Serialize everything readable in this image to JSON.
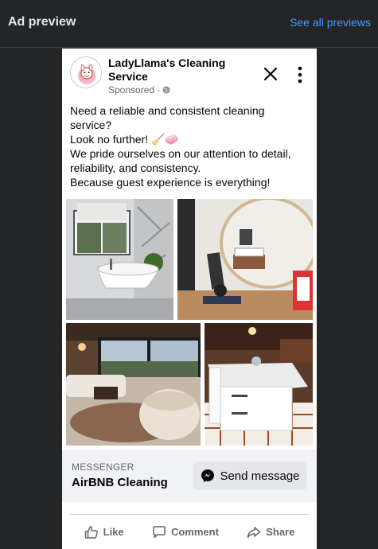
{
  "topbar": {
    "title": "Ad preview",
    "see_all": "See all previews"
  },
  "post": {
    "page_name": "LadyLlama's Cleaning Service",
    "sponsored": "Sponsored ·",
    "body": [
      "Need a reliable and consistent cleaning",
      "service?",
      "Look no further! 🧹🧼",
      "We pride ourselves on our attention to detail,",
      "reliability, and consistency.",
      "Because guest experience is everything!"
    ],
    "images": [
      "bathroom-tub-photo",
      "bedroom-mirror-photo",
      "living-room-photo",
      "kitchen-island-photo"
    ]
  },
  "cta": {
    "source": "MESSENGER",
    "headline": "AirBNB Cleaning",
    "button": "Send message"
  },
  "actions": {
    "like": "Like",
    "comment": "Comment",
    "share": "Share"
  },
  "colors": {
    "background": "#242526",
    "link": "#4599ff",
    "card": "#ffffff"
  }
}
